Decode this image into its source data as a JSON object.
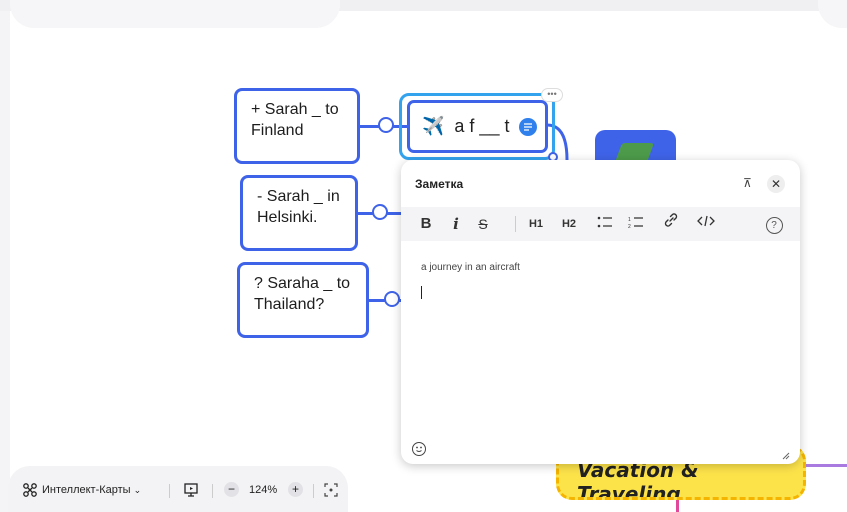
{
  "canvas": {
    "nodes": [
      {
        "id": "positive",
        "text": "+ Sarah _ to Finland",
        "lines": [
          "+ Sarah _ to",
          "Finland"
        ]
      },
      {
        "id": "negative",
        "text": "- Sarah _ in Helsinki.",
        "lines": [
          "- Sarah _ in",
          "Helsinki."
        ]
      },
      {
        "id": "question",
        "text": "? Saraha _ to Thailand?",
        "lines": [
          "? Saraha _ to",
          "Thailand?"
        ]
      }
    ],
    "center_node": {
      "icon": "airplane-icon",
      "emoji": "✈️",
      "text": "a f __ t"
    },
    "vacation_node": {
      "text": "Vacation & Traveling"
    }
  },
  "note_panel": {
    "title": "Заметка",
    "pin_glyph": "⊼",
    "close_glyph": "✕",
    "toolbar": {
      "bold": "B",
      "italic": "i",
      "strike": "S",
      "h1": "H1",
      "h2": "H2",
      "bullet_list": "bullet-list-icon",
      "numbered_list": "numbered-list-icon",
      "link": "link-icon",
      "code": "code-icon",
      "help": "?"
    },
    "content": "a journey in an aircraft"
  },
  "bottom_bar": {
    "mode_label": "Интеллект-Карты",
    "zoom_minus": "−",
    "zoom_level": "124%",
    "zoom_plus": "+"
  },
  "colors": {
    "node_border": "#3f63e8",
    "selected_outline": "#33a3ee",
    "note_indicator": "#2f80ed",
    "vacation_fill": "#fde34a"
  }
}
